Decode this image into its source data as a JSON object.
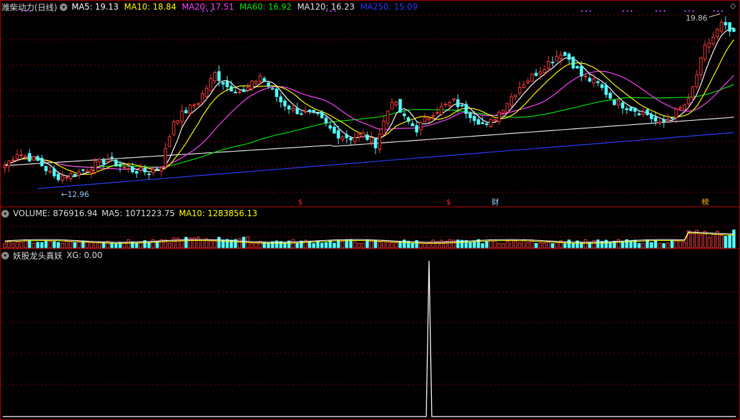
{
  "title": "潍柴动力(日线)",
  "colors": {
    "up": "#ff3c3c",
    "down": "#54ffff",
    "ma5": "#ffffff",
    "ma10": "#ffff00",
    "ma20": "#ff44ff",
    "ma60": "#00e400",
    "ma120": "#e6e6e6",
    "ma250": "#2b3cff",
    "grid": "#8a0000",
    "signal": "#ffffff",
    "marker_s": "#ff2020",
    "marker_cai": "#9ad0ff",
    "marker_bang": "#ffb000"
  },
  "indicators": [
    {
      "label": "MA5",
      "value": "19.13",
      "color": "#ffffff"
    },
    {
      "label": "MA10",
      "value": "18.84",
      "color": "#ffff00"
    },
    {
      "label": "MA20",
      "value": "17.51",
      "color": "#ff44ff"
    },
    {
      "label": "MA60",
      "value": "16.92",
      "color": "#00e400"
    },
    {
      "label": "MA120",
      "value": "16.23",
      "color": "#e6e6e6"
    },
    {
      "label": "MA250",
      "value": "15.09",
      "color": "#2b3cff"
    }
  ],
  "volume_header": {
    "label": "VOLUME",
    "value": "876916.94",
    "ma5_label": "MA5",
    "ma5_value": "1071223.75",
    "ma10_label": "MA10",
    "ma10_value": "1283856.13"
  },
  "indicator_header": {
    "name": "妖股龙头真妖",
    "label": "XG",
    "value": "0.00"
  },
  "annotations": {
    "high_label": "19.86",
    "low_label": "12.96",
    "corner_icon": "◇"
  },
  "markers": [
    {
      "text": "$",
      "bar_index": 72
    },
    {
      "text": "$",
      "bar_index": 108
    },
    {
      "text": "财",
      "bar_index": 119
    },
    {
      "text": "榜",
      "bar_index": 170
    }
  ],
  "chart_data": {
    "type": "candlestick",
    "n_bars": 178,
    "price_ylim": [
      12.0,
      20.6
    ],
    "anchors": [
      [
        0,
        13.5
      ],
      [
        3,
        14.1
      ],
      [
        8,
        13.7
      ],
      [
        12,
        12.96
      ],
      [
        17,
        13.1
      ],
      [
        22,
        13.55
      ],
      [
        25,
        13.8
      ],
      [
        30,
        13.3
      ],
      [
        35,
        13.2
      ],
      [
        38,
        13.5
      ],
      [
        41,
        15.6
      ],
      [
        47,
        16.5
      ],
      [
        51,
        17.8
      ],
      [
        54,
        17.2
      ],
      [
        58,
        16.9
      ],
      [
        62,
        17.7
      ],
      [
        67,
        16.5
      ],
      [
        70,
        16.1
      ],
      [
        76,
        15.8
      ],
      [
        80,
        15.0
      ],
      [
        84,
        14.8
      ],
      [
        87,
        14.95
      ],
      [
        90,
        14.5
      ],
      [
        94,
        16.6
      ],
      [
        97,
        15.7
      ],
      [
        100,
        15.2
      ],
      [
        104,
        16.0
      ],
      [
        109,
        16.5
      ],
      [
        113,
        15.9
      ],
      [
        117,
        15.3
      ],
      [
        120,
        16.0
      ],
      [
        125,
        17.2
      ],
      [
        130,
        18.0
      ],
      [
        135,
        18.8
      ],
      [
        137,
        18.5
      ],
      [
        140,
        17.7
      ],
      [
        144,
        17.3
      ],
      [
        148,
        16.5
      ],
      [
        153,
        16.1
      ],
      [
        156,
        15.9
      ],
      [
        159,
        15.4
      ],
      [
        163,
        16.0
      ],
      [
        166,
        16.5
      ],
      [
        170,
        19.0
      ],
      [
        172,
        19.5
      ],
      [
        174,
        20.1
      ],
      [
        177,
        19.6
      ]
    ],
    "xg_signal_bar": 103,
    "xg_ylim": [
      0,
      1
    ],
    "xg_peak": 1
  }
}
